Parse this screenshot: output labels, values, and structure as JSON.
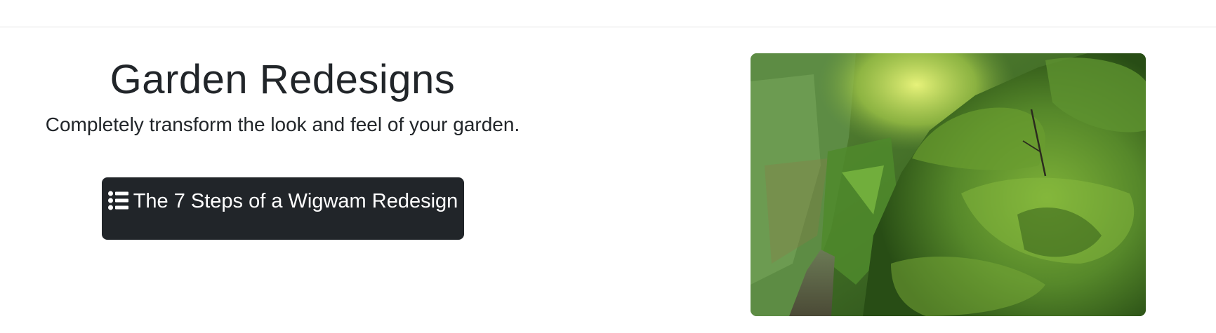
{
  "hero": {
    "title": "Garden Redesigns",
    "subtitle": "Completely transform the look and feel of your garden.",
    "cta_label": "The 7 Steps of a Wigwam Redesign",
    "cta_icon": "list-icon"
  },
  "image": {
    "subject": "moss-covered-garden-path-photo"
  },
  "colors": {
    "button_bg": "#212529",
    "text": "#212529",
    "button_text": "#ffffff",
    "divider": "#e3e3e3"
  }
}
